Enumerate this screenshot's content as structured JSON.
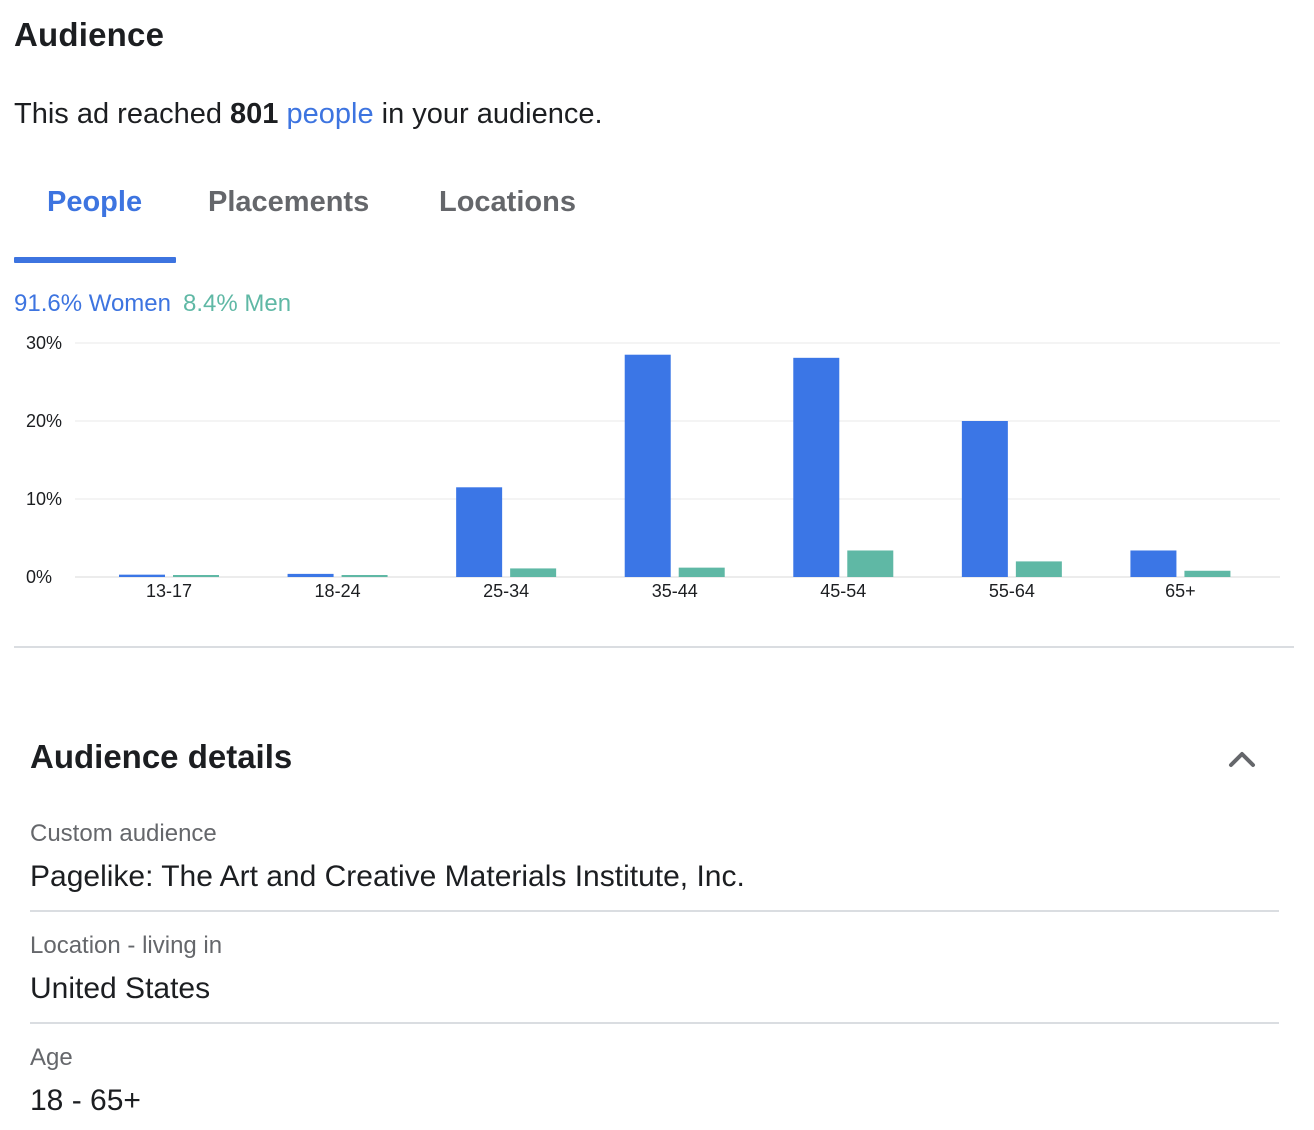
{
  "header": {
    "title": "Audience"
  },
  "reach": {
    "prefix": "This ad reached",
    "count": "801",
    "link": "people",
    "suffix": "in your audience."
  },
  "tabs": [
    {
      "label": "People",
      "active": true
    },
    {
      "label": "Placements",
      "active": false
    },
    {
      "label": "Locations",
      "active": false
    }
  ],
  "gender_split": {
    "women": "91.6% Women",
    "men": "8.4% Men"
  },
  "colors": {
    "accent": "#3d74e0",
    "women": "#3b76e6",
    "men": "#5fb8a5",
    "grid": "#e8e8e8"
  },
  "chart_data": {
    "type": "bar",
    "categories": [
      "13-17",
      "18-24",
      "25-34",
      "35-44",
      "45-54",
      "55-64",
      "65+"
    ],
    "series": [
      {
        "name": "Women",
        "values": [
          0.3,
          0.4,
          11.5,
          28.5,
          28.1,
          20.0,
          3.4
        ]
      },
      {
        "name": "Men",
        "values": [
          0.2,
          0.2,
          1.1,
          1.2,
          3.4,
          2.0,
          0.8
        ]
      }
    ],
    "yticks": [
      "0%",
      "10%",
      "20%",
      "30%"
    ],
    "ylim": [
      0,
      30
    ],
    "grid": true
  },
  "details": {
    "title": "Audience details",
    "collapse_icon": "chevron-up-icon",
    "fields": [
      {
        "label": "Custom audience",
        "value": "Pagelike: The Art and Creative Materials Institute, Inc."
      },
      {
        "label": "Location - living in",
        "value": "United States"
      },
      {
        "label": "Age",
        "value": "18 - 65+"
      }
    ]
  }
}
